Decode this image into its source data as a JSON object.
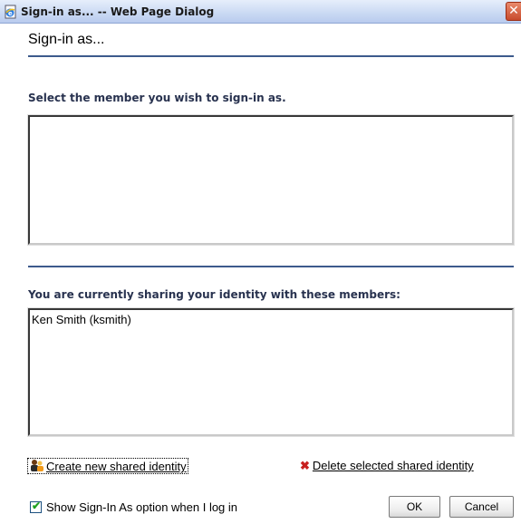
{
  "window": {
    "title": "Sign-in as... -- Web Page Dialog",
    "close_glyph": "✕"
  },
  "dialog": {
    "heading": "Sign-in as...",
    "select_label": "Select the member you wish to sign-in as.",
    "select_options": [],
    "shared_label": "You are currently sharing your identity with these members:",
    "shared_members": [
      "Ken Smith (ksmith)"
    ]
  },
  "actions": {
    "create_link": "Create new shared identity",
    "delete_link": "Delete selected shared identity",
    "show_option_label": "Show Sign-In As option when I log in",
    "show_option_checked": true,
    "ok_label": "OK",
    "cancel_label": "Cancel"
  },
  "icons": {
    "window": "ie-page-icon",
    "create": "people-icon",
    "delete": "red-x-icon"
  },
  "colors": {
    "accent": "#3d5a8c",
    "delete_icon": "#c8201f"
  }
}
